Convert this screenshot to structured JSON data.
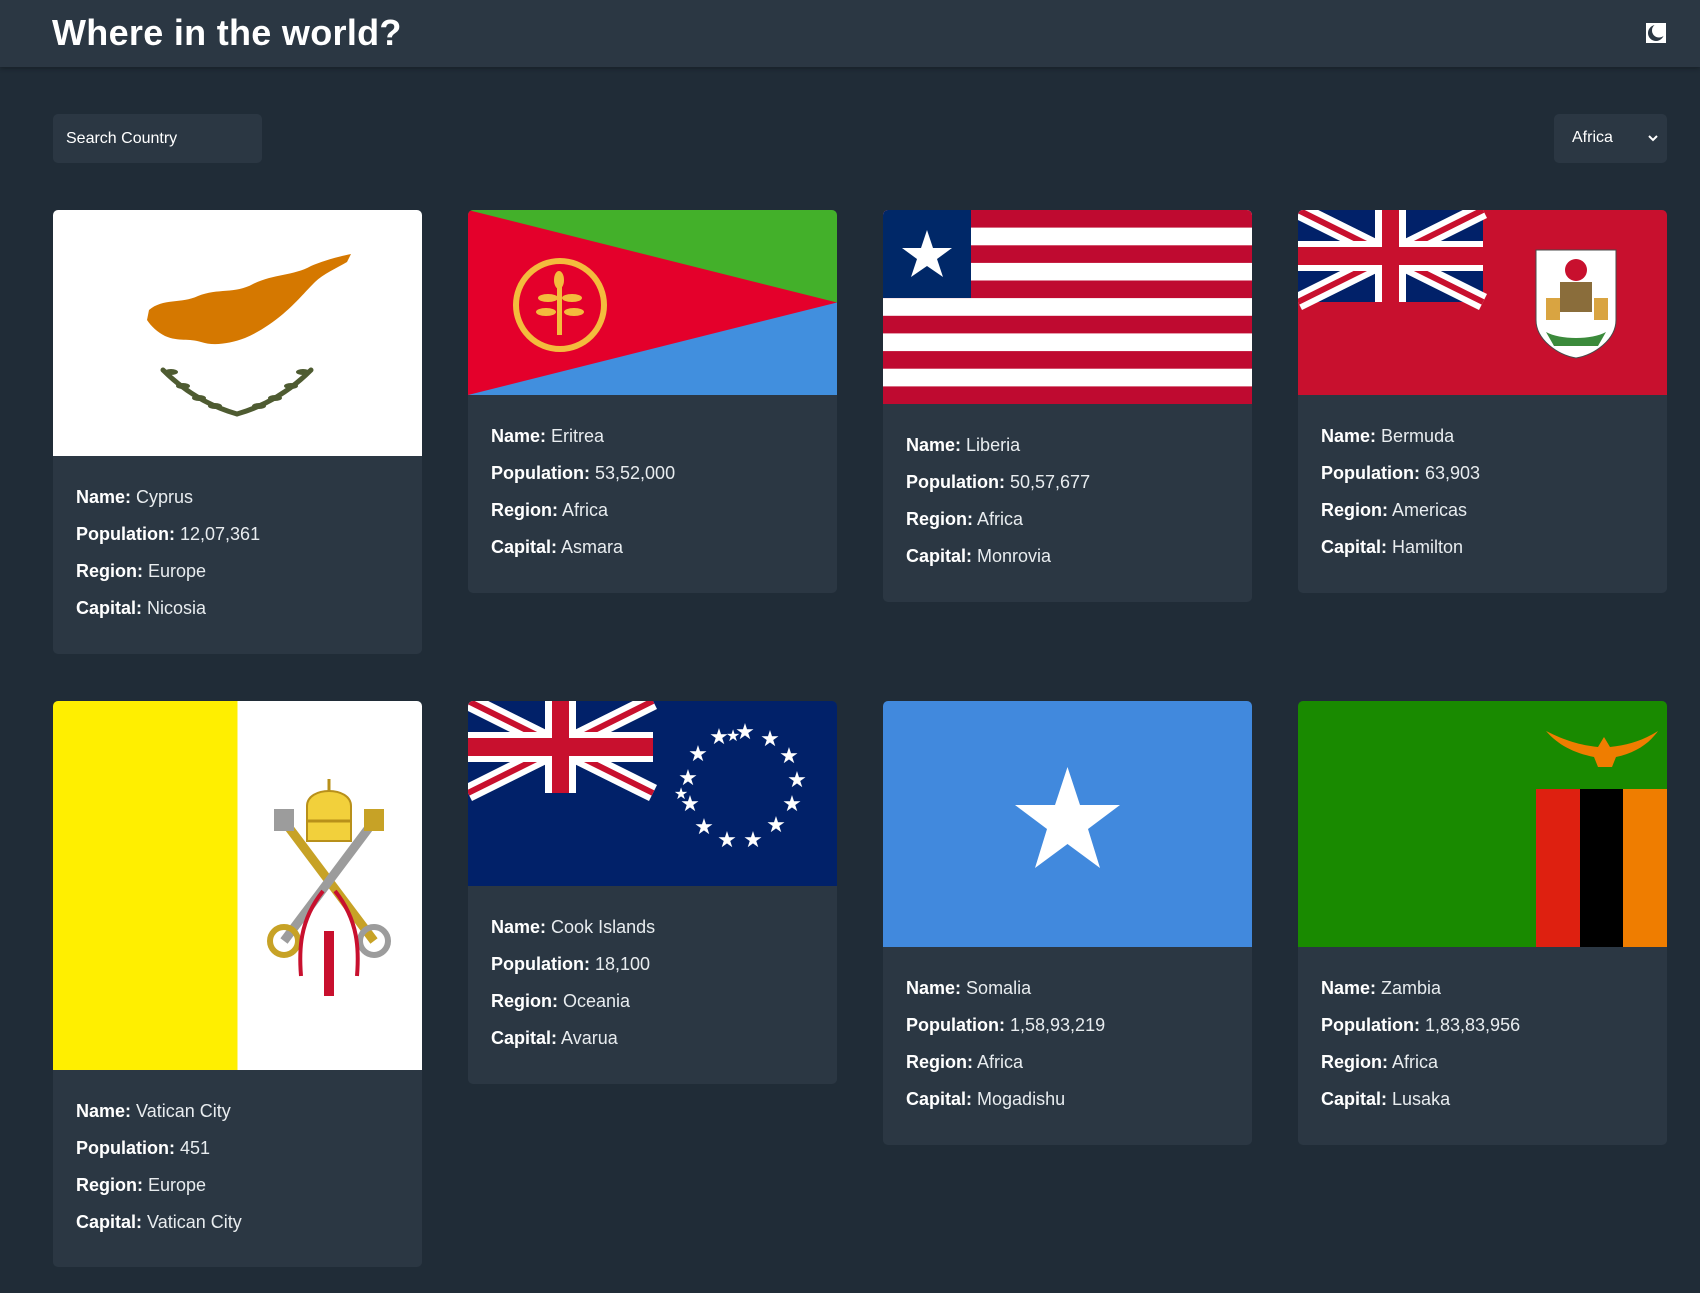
{
  "header": {
    "title": "Where in the world?",
    "theme_toggle_icon": "half-moon-icon"
  },
  "search": {
    "placeholder": "Search Country",
    "icon": "none"
  },
  "filter": {
    "selected": "Africa",
    "icon": "chevron-down-icon"
  },
  "labels": {
    "name": "Name:",
    "population": "Population:",
    "region": "Region:",
    "capital": "Capital:"
  },
  "countries": [
    {
      "name": "Cyprus",
      "population": "12,07,361",
      "region": "Europe",
      "capital": "Nicosia",
      "flag": "cyprus-flag"
    },
    {
      "name": "Eritrea",
      "population": "53,52,000",
      "region": "Africa",
      "capital": "Asmara",
      "flag": "eritrea-flag"
    },
    {
      "name": "Liberia",
      "population": "50,57,677",
      "region": "Africa",
      "capital": "Monrovia",
      "flag": "liberia-flag"
    },
    {
      "name": "Bermuda",
      "population": "63,903",
      "region": "Americas",
      "capital": "Hamilton",
      "flag": "bermuda-flag"
    },
    {
      "name": "Vatican City",
      "population": "451",
      "region": "Europe",
      "capital": "Vatican City",
      "flag": "vatican-flag"
    },
    {
      "name": "Cook Islands",
      "population": "18,100",
      "region": "Oceania",
      "capital": "Avarua",
      "flag": "cook-islands-flag"
    },
    {
      "name": "Somalia",
      "population": "1,58,93,219",
      "region": "Africa",
      "capital": "Mogadishu",
      "flag": "somalia-flag"
    },
    {
      "name": "Zambia",
      "population": "1,83,83,956",
      "region": "Africa",
      "capital": "Lusaka",
      "flag": "zambia-flag"
    }
  ],
  "colors": {
    "background": "#202c37",
    "elements": "#2b3743",
    "text": "#ffffff"
  }
}
